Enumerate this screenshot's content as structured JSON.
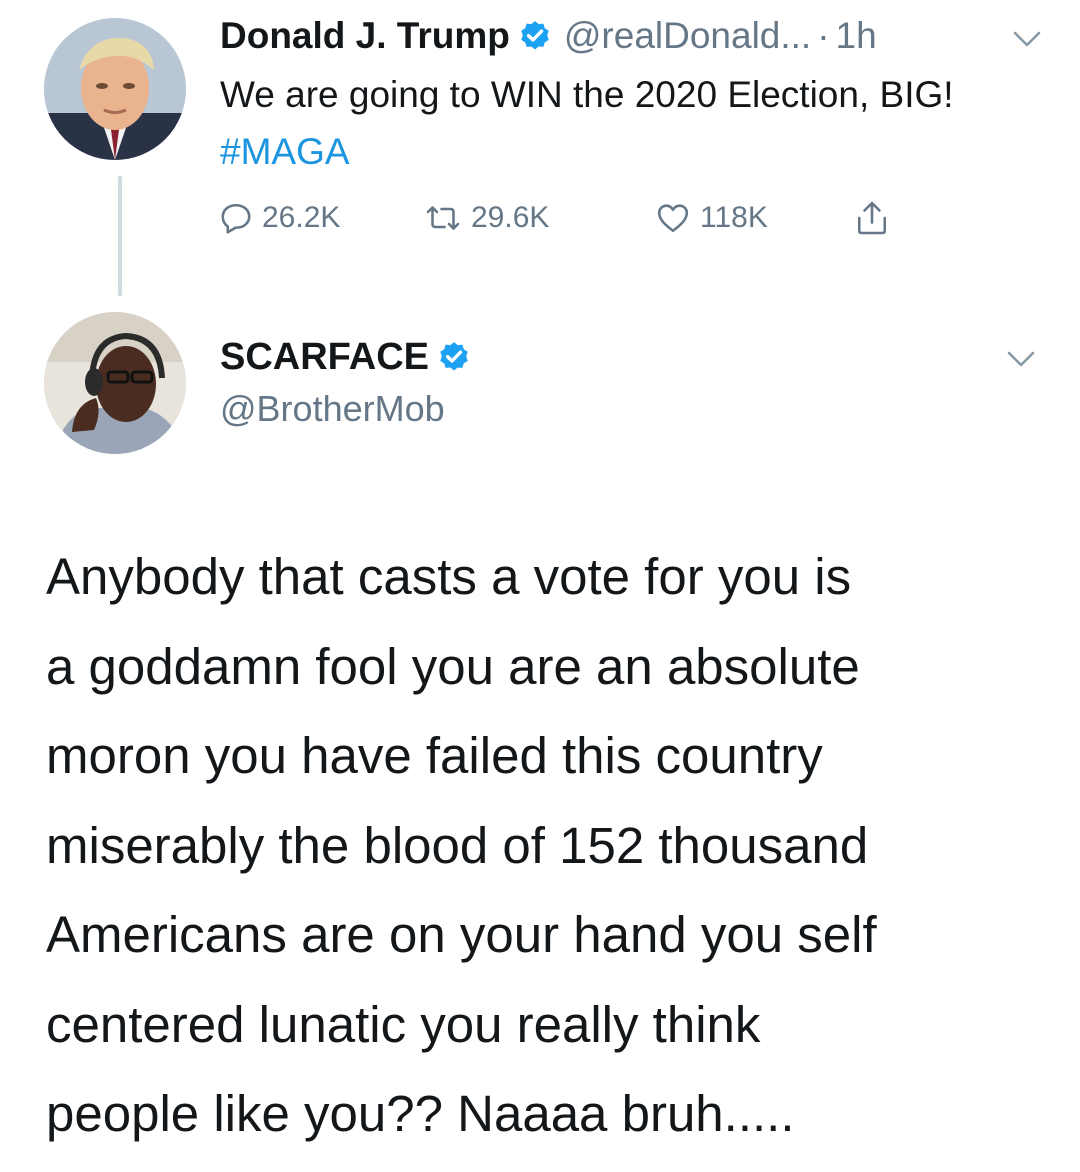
{
  "original_tweet": {
    "author_name": "Donald J. Trump",
    "handle": "@realDonald...",
    "separator": "·",
    "time": "1h",
    "text_main": "We are going to WIN the 2020 Election, BIG! ",
    "hashtag": "#MAGA",
    "replies": "26.2K",
    "retweets": "29.6K",
    "likes": "118K",
    "verified": true
  },
  "reply_tweet": {
    "author_name": "SCARFACE",
    "handle": "@BrotherMob",
    "verified": true,
    "text": "Anybody that casts a vote for you is\na goddamn fool you are an absolute\nmoron you have failed this country\nmiserably the blood of 152 thousand\nAmericans are on your hand you self\ncentered lunatic you really think\npeople like you?? Naaaa bruh....."
  },
  "icons": {
    "verified": "verified-badge-icon",
    "chevron": "chevron-down-icon",
    "reply": "reply-icon",
    "retweet": "retweet-icon",
    "like": "heart-icon",
    "share": "share-icon"
  },
  "colors": {
    "text": "#14171a",
    "secondary": "#657786",
    "link": "#1b95e0",
    "verified": "#1da1f2",
    "thread_line": "#cfd9de"
  }
}
